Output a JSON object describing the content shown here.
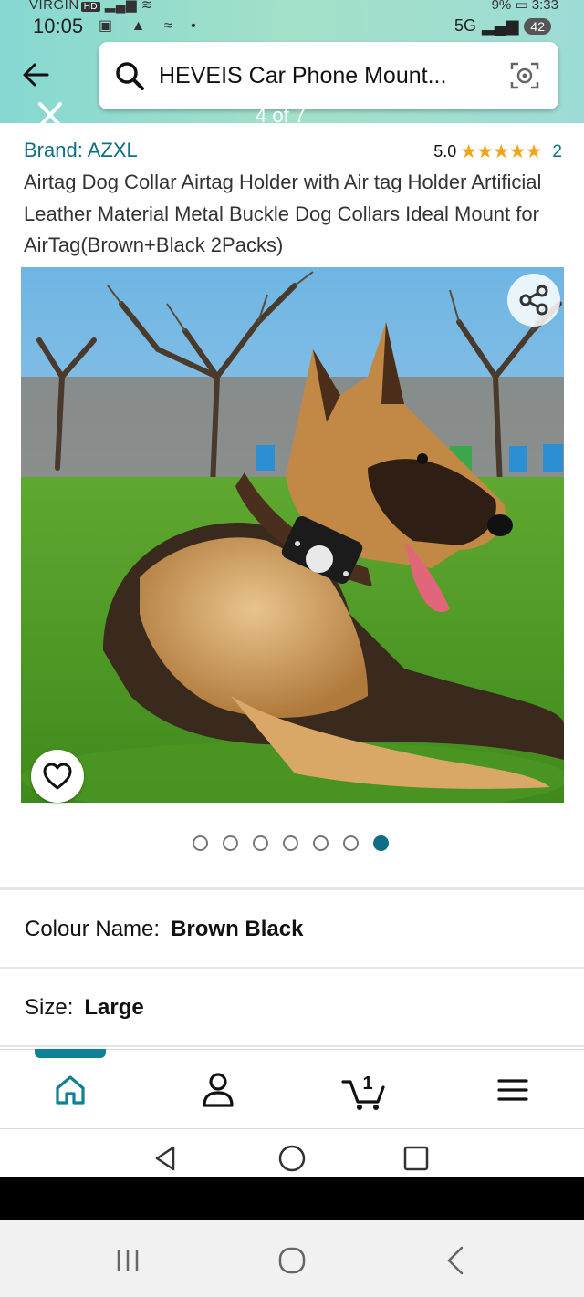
{
  "status_bar": {
    "carrier": "VIRGIN",
    "hd_badge": "HD",
    "time": "10:05",
    "battery_percent": "9%",
    "secondary_time": "3:33",
    "network": "5G",
    "notification_count": "42"
  },
  "search": {
    "query": "HEVEIS Car Phone Mount..."
  },
  "image_counter": "4 of 7",
  "product": {
    "brand": "Brand: AZXL",
    "rating_value": "5.0",
    "stars": "★★★★★",
    "rating_count": "2",
    "title": "Airtag Dog Collar Airtag Holder with Air tag Holder Artificial Leather Material Metal Buckle Dog Collars Ideal Mount for AirTag(Brown+Black 2Packs)"
  },
  "carousel": {
    "total": 7,
    "active_index": 6
  },
  "options": {
    "colour_label": "Colour Name:",
    "colour_value": "Brown Black",
    "size_label": "Size:",
    "size_value": "Large"
  },
  "bottom_nav": {
    "cart_count": "1",
    "active_tab": "home"
  },
  "colors": {
    "accent": "#0f6d85",
    "star": "#f5a31a",
    "header_gradient": "#9ddcd6"
  }
}
